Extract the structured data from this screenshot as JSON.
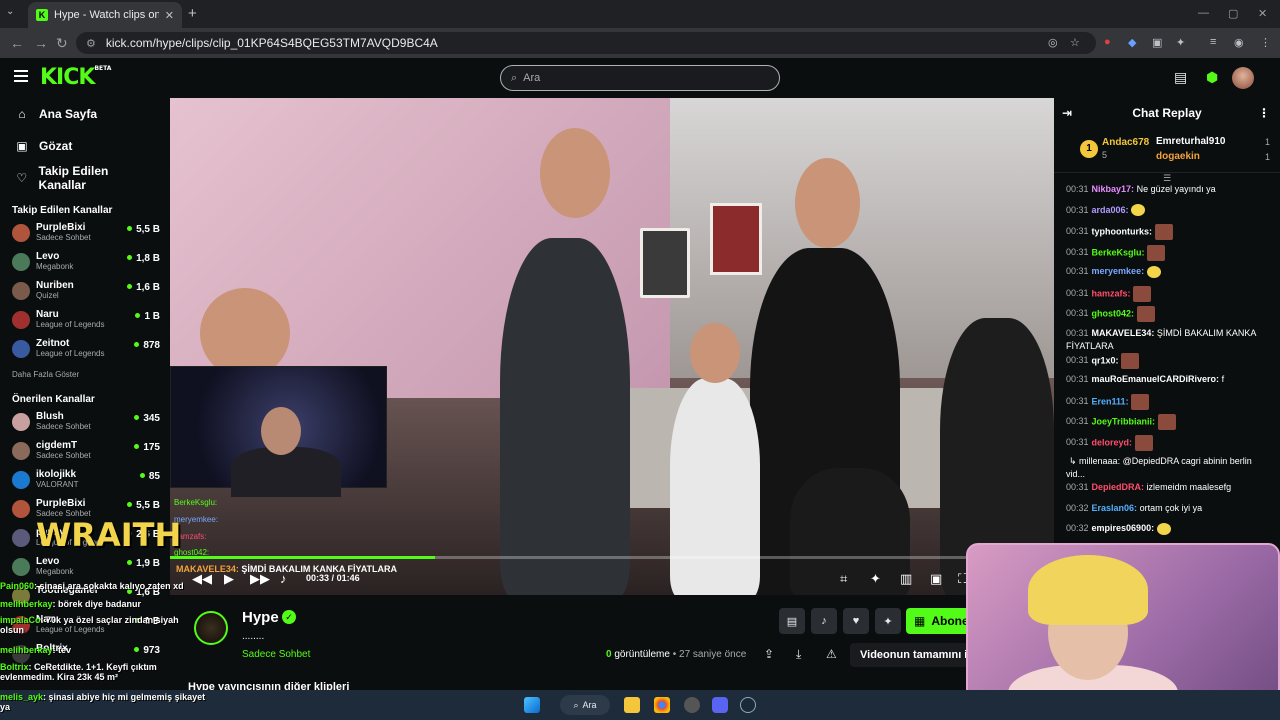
{
  "browser": {
    "tab_title": "Hype - Watch clips on Kick",
    "new_tab": "+",
    "tab_menu": "⌄",
    "tab_close": "✕",
    "url": "kick.com/hype/clips/clip_01KP64S4BQEG53TM7AVQD9BC4A",
    "min": "—",
    "max": "▢",
    "close": "✕"
  },
  "header": {
    "logo": "KICK",
    "logo_badge": "BETA",
    "search_placeholder": "Ara"
  },
  "sidebar": {
    "nav": [
      {
        "label": "Ana Sayfa",
        "icon": "home-icon"
      },
      {
        "label": "Gözat",
        "icon": "browse-icon"
      },
      {
        "label": "Takip Edilen Kanallar",
        "icon": "heart-icon"
      }
    ],
    "followed_title": "Takip Edilen Kanallar",
    "followed": [
      {
        "name": "PurpleBixi",
        "category": "Sadece Sohbet",
        "viewers": "5,5 B",
        "color": "#b0543b"
      },
      {
        "name": "Levo",
        "category": "Megabonk",
        "viewers": "1,8 B",
        "color": "#4a7a5a"
      },
      {
        "name": "Nuriben",
        "category": "Quizel",
        "viewers": "1,6 B",
        "color": "#7a5a4a"
      },
      {
        "name": "Naru",
        "category": "League of Legends",
        "viewers": "1 B",
        "color": "#a03030"
      },
      {
        "name": "Zeitnot",
        "category": "League of Legends",
        "viewers": "878",
        "color": "#3a5aa0"
      }
    ],
    "show_more": "Daha Fazla Göster",
    "recommended_title": "Önerilen Kanallar",
    "recommended": [
      {
        "name": "Blush",
        "category": "Sadece Sohbet",
        "viewers": "345",
        "color": "#c9a0a0"
      },
      {
        "name": "cigdemT",
        "category": "Sadece Sohbet",
        "viewers": "175",
        "color": "#8a6a5a"
      },
      {
        "name": "ikolojikk",
        "category": "VALORANT",
        "viewers": "85",
        "color": "#1a7ad0"
      },
      {
        "name": "PurpleBixi",
        "category": "Sadece Sohbet",
        "viewers": "5,5 B",
        "color": "#b0543b"
      },
      {
        "name": "panky",
        "category": "League of Legends",
        "viewers": "2,6 B",
        "color": "#5a5a7a"
      },
      {
        "name": "Levo",
        "category": "Megabonk",
        "viewers": "1,9 B",
        "color": "#4a7a5a"
      },
      {
        "name": "Toothegamer",
        "category": "",
        "viewers": "1,6 B",
        "color": "#7a7a3a"
      },
      {
        "name": "Naru",
        "category": "League of Legends",
        "viewers": "1 B",
        "color": "#a03030"
      },
      {
        "name": "Boltrix",
        "category": "",
        "viewers": "973",
        "color": "#3a3a3a"
      }
    ]
  },
  "video": {
    "overlay_brand": "WRAITH",
    "subtitle_user": "MAKAVELE34:",
    "subtitle_text": "ŞİMDİ BAKALIM KANKA FİYATLARA",
    "progress": 0.3,
    "time_current": "00:33",
    "time_sep": "/",
    "time_total": "01:46",
    "webcam_chat": [
      "BerkeKsglu:",
      "meryemkee:",
      "hamzafs:",
      "ghost042:"
    ]
  },
  "channel": {
    "name": "Hype",
    "description": "........",
    "category": "Sadece Sohbet",
    "subscribe": "Abone ol",
    "views_count": "0",
    "views_label": "görüntüleme",
    "dot": "•",
    "ago": "27 saniye önce",
    "full_video": "Videonun tamamını izle",
    "other_clips": "Hype yayıncısının diğer klipleri"
  },
  "chat": {
    "title": "Chat Replay",
    "top_gifter": {
      "rank": "1",
      "name": "Andac678",
      "count": "5"
    },
    "gifters": [
      {
        "name": "Emreturhal910",
        "count": "1"
      },
      {
        "name": "dogaekin",
        "count": "1"
      }
    ],
    "messages": [
      {
        "time": "00:31",
        "user": "Nikbay17:",
        "text": "Ne güzel yayındı ya",
        "color": "#e88bff",
        "emote": ""
      },
      {
        "time": "00:31",
        "user": "arda006:",
        "text": "",
        "color": "#b09cff",
        "emote": "y"
      },
      {
        "time": "00:31",
        "user": "typhoonturks:",
        "text": "",
        "color": "#ffffff",
        "emote": "e"
      },
      {
        "time": "00:31",
        "user": "BerkeKsglu:",
        "text": "",
        "color": "#53fc18",
        "emote": "e"
      },
      {
        "time": "00:31",
        "user": "meryemkee:",
        "text": "",
        "color": "#7aa7ff",
        "emote": "y"
      },
      {
        "time": "00:31",
        "user": "hamzafs:",
        "text": "",
        "color": "#ff4d6d",
        "emote": "e"
      },
      {
        "time": "00:31",
        "user": "ghost042:",
        "text": "",
        "color": "#53fc18",
        "emote": "e"
      },
      {
        "time": "00:31",
        "user": "MAKAVELE34:",
        "text": "ŞİMDİ BAKALIM KANKA FİYATLARA",
        "color": "#ffffff",
        "emote": ""
      },
      {
        "time": "00:31",
        "user": "qr1x0:",
        "text": "",
        "color": "#ffffff",
        "emote": "e"
      },
      {
        "time": "00:31",
        "user": "mauRoEmanuelCARDiRivero:",
        "text": "f",
        "color": "#ffffff",
        "emote": ""
      },
      {
        "time": "00:31",
        "user": "Eren111:",
        "text": "",
        "color": "#53b0ff",
        "emote": "e"
      },
      {
        "time": "00:31",
        "user": "JoeyTribbianii:",
        "text": "",
        "color": "#53fc18",
        "emote": "e"
      },
      {
        "time": "00:31",
        "user": "deloreyd:",
        "text": "",
        "color": "#ff4d6d",
        "emote": "e"
      },
      {
        "time": "",
        "user": "",
        "text": "↳ millenaaa: @DepiedDRA cagri abinin berlin vid...",
        "color": "#a8abae",
        "emote": ""
      },
      {
        "time": "00:31",
        "user": "DepiedDRA:",
        "text": "izlemeidm maalesefg",
        "color": "#ff4d6d",
        "emote": ""
      },
      {
        "time": "00:32",
        "user": "Eraslan06:",
        "text": "ortam çok iyi ya",
        "color": "#53b0ff",
        "emote": ""
      },
      {
        "time": "00:32",
        "user": "empires06900:",
        "text": "",
        "color": "#ffffff",
        "emote": "y"
      }
    ]
  },
  "overlay_chat": [
    {
      "user": "Pain060",
      "text": ": şinasi ara sokakta kalıyo zaten xd"
    },
    {
      "user": "melihberkay",
      "text": ": börek diye badanur"
    },
    {
      "user": "impalaCo",
      "text": ": 70k ya özel saçlar zindan siyah olsun"
    },
    {
      "user": "melihberkay",
      "text": ": tev"
    },
    {
      "user": "Boltrix",
      "text": ": CeRetdikte. 1+1. Keyfi çıktım evlenmedim. Kira 23k 45 m²"
    },
    {
      "user": "melis_ayk",
      "text": ": şinasi abiye hiç mi gelmemiş şikayet ya"
    }
  ],
  "taskbar": {
    "search": "Ara"
  }
}
